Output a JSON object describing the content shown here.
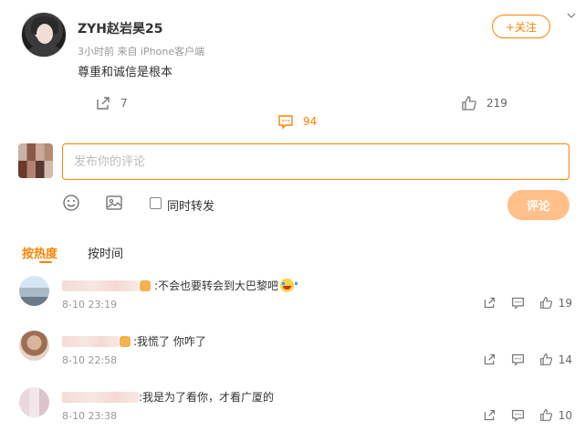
{
  "post": {
    "username": "ZYH赵岩昊25",
    "time": "3小时前",
    "source": "来自 iPhone客户端",
    "text": "尊重和诚信是根本",
    "follow_label": "+关注"
  },
  "actions": {
    "repost_count": "7",
    "comment_count": "94",
    "like_count": "219"
  },
  "composer": {
    "placeholder": "发布你的评论",
    "repost_label": "同时转发",
    "submit_label": "评论"
  },
  "sort": {
    "hot_label": "按热度",
    "time_label": "按时间"
  },
  "comments": [
    {
      "text": ":不会也要转会到大巴黎吧",
      "time": "8-10 23:19",
      "likes": "19"
    },
    {
      "text": ":我慌了 你咋了",
      "time": "8-10 22:58",
      "likes": "14"
    },
    {
      "text": ":我是为了看你，才看广厦的",
      "time": "8-10 23:38",
      "likes": "10"
    }
  ],
  "colors": {
    "accent": "#ff8200",
    "submit_disabled": "#ffc08a"
  }
}
